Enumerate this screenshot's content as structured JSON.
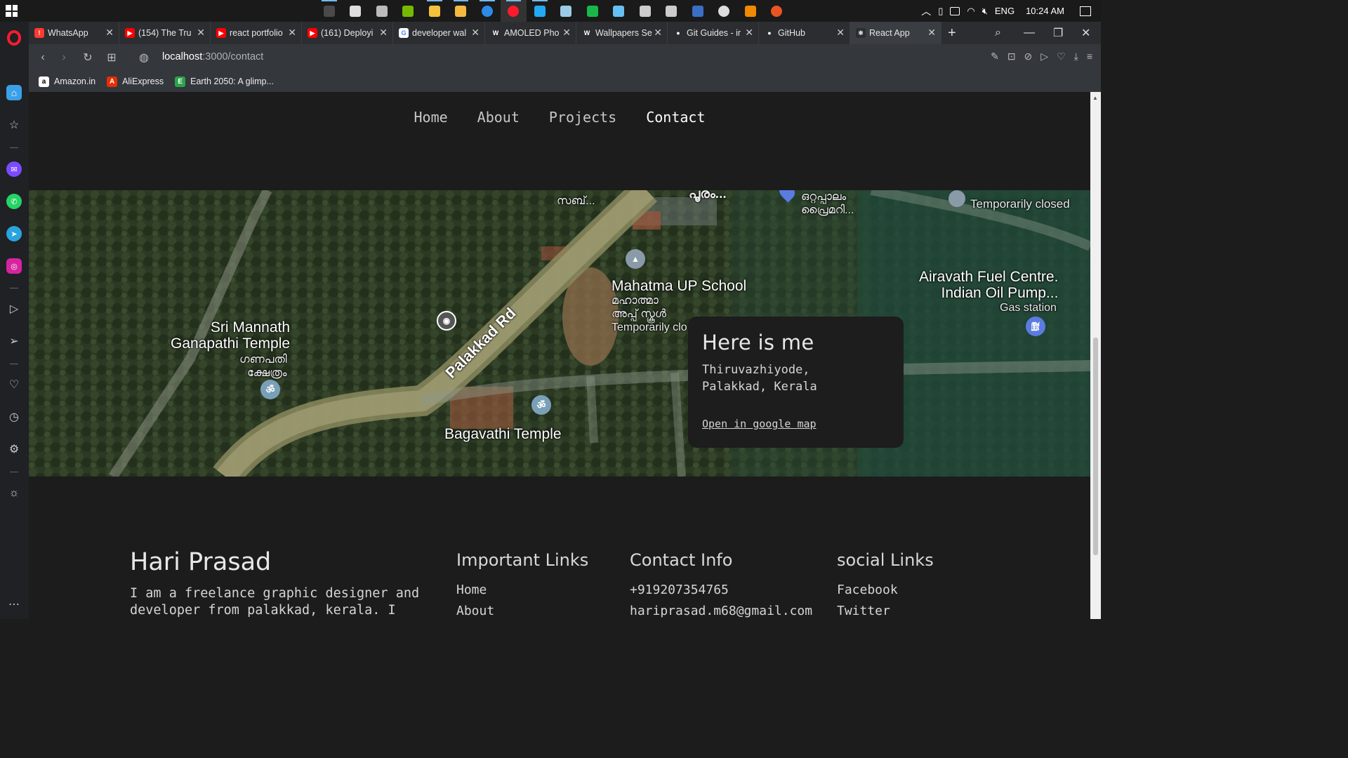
{
  "taskbar": {
    "language": "ENG",
    "time": "10:24 AM",
    "apps": [
      {
        "icon": "wireshark-icon",
        "color": "#4a4a4a"
      },
      {
        "icon": "terminal-icon",
        "color": "#dddddd"
      },
      {
        "icon": "console-icon",
        "color": "#bbbbbb"
      },
      {
        "icon": "nvidia-icon",
        "color": "#76b900"
      },
      {
        "icon": "file-explorer-icon",
        "color": "#f3c23c"
      },
      {
        "icon": "folder-icon",
        "color": "#f5b942"
      },
      {
        "icon": "firefox-icon",
        "color": "#2e8ae6"
      },
      {
        "icon": "opera-icon",
        "color": "#ff1b2d"
      },
      {
        "icon": "vscode-icon",
        "color": "#23a9f2"
      },
      {
        "icon": "image-viewer-icon",
        "color": "#9ccbe8"
      },
      {
        "icon": "green-app-icon",
        "color": "#19b74a"
      },
      {
        "icon": "steam-icon",
        "color": "#66c0f4"
      },
      {
        "icon": "window-app-icon",
        "color": "#cccccc"
      },
      {
        "icon": "window-app-2-icon",
        "color": "#cccccc"
      },
      {
        "icon": "powershell-icon",
        "color": "#3a6fc4"
      },
      {
        "icon": "obs-icon",
        "color": "#dddddd"
      },
      {
        "icon": "vlc-icon",
        "color": "#f08a00"
      },
      {
        "icon": "ubuntu-icon",
        "color": "#e95420"
      }
    ]
  },
  "browser": {
    "tabs": [
      {
        "label": "WhatsApp",
        "fav_color": "#ff3b30",
        "fav_text": "!"
      },
      {
        "label": "(154) The Tru",
        "fav_color": "#ff0000",
        "fav_text": "▶"
      },
      {
        "label": "react portfolio",
        "fav_color": "#ff0000",
        "fav_text": "▶"
      },
      {
        "label": "(161) Deployi",
        "fav_color": "#ff0000",
        "fav_text": "▶"
      },
      {
        "label": "developer wal",
        "fav_color": "#ffffff",
        "fav_text": "G"
      },
      {
        "label": "AMOLED Pho",
        "fav_color": "#2b2d31",
        "fav_text": "W"
      },
      {
        "label": "Wallpapers Se",
        "fav_color": "#2b2d31",
        "fav_text": "W"
      },
      {
        "label": "Git Guides - ir",
        "fav_color": "#2b2d31",
        "fav_text": "●"
      },
      {
        "label": "GitHub",
        "fav_color": "#2b2d31",
        "fav_text": "●"
      },
      {
        "label": "React App",
        "fav_color": "#2b2d31",
        "fav_text": "⚛"
      }
    ],
    "active_tab": 9,
    "url_host": "localhost",
    "url_path": ":3000/contact",
    "bookmarks": [
      {
        "label": "Amazon.in",
        "fav_color": "#ffffff",
        "fav_text": "a"
      },
      {
        "label": "AliExpress",
        "fav_color": "#e62e04",
        "fav_text": "A"
      },
      {
        "label": "Earth 2050: A glimp...",
        "fav_color": "#2aa34a",
        "fav_text": "E"
      }
    ]
  },
  "site": {
    "nav": [
      "Home",
      "About",
      "Projects",
      "Contact"
    ],
    "current_nav": "Contact",
    "map": {
      "labels": {
        "road": "Palakkad Rd",
        "sri_temple_en": "Sri Mannath\nGanapathi Temple",
        "sri_temple_ml": "ഗണപതി\nക്ഷേത്രം",
        "school_en": "Mahatma UP School",
        "school_ml": "മഹാത്മാ\nഅപ്പ് സ്കൂൾ",
        "school_status": "Temporarily clo",
        "bagavathi": "Bagavathi Temple",
        "fuel_name": "Airavath Fuel Centre.\nIndian Oil Pump...",
        "fuel_type": "Gas station",
        "college_status": "Temporarily closed",
        "top_1": "സബ്...",
        "top_2": "പൂരം...",
        "top_3": "ഒറ്റപ്പാലം\nപ്രൈമറി..."
      }
    },
    "card": {
      "title": "Here is me",
      "address_line1": "Thiruvazhiyode,",
      "address_line2": "Palakkad, Kerala",
      "link": "Open in google map"
    },
    "footer": {
      "name": "Hari Prasad",
      "description": "I am a freelance graphic designer and developer from palakkad, kerala. I",
      "important_links": {
        "heading": "Important Links",
        "items": [
          "Home",
          "About"
        ]
      },
      "contact_info": {
        "heading": "Contact Info",
        "items": [
          "+919207354765",
          "hariprasad.m68@gmail.com"
        ]
      },
      "social_links": {
        "heading": "social Links",
        "items": [
          "Facebook",
          "Twitter"
        ]
      }
    }
  }
}
